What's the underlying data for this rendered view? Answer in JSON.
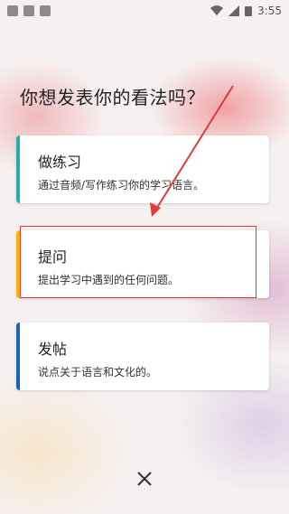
{
  "status_bar": {
    "time": "3:55"
  },
  "title": "你想发表你的看法吗？",
  "cards": [
    {
      "heading": "做练习",
      "description": "通过音频/写作练习你的学习语言。",
      "accent_color": "#2aa9b3"
    },
    {
      "heading": "提问",
      "description": "提出学习中遇到的任何问题。",
      "accent_color": "#f4b400"
    },
    {
      "heading": "发帖",
      "description": "说点关于语言和文化的。",
      "accent_color": "#1565c0"
    }
  ],
  "colors": {
    "highlight_box": "#e03a3a",
    "arrow": "#e03a3a"
  },
  "icons": {
    "close": "close-icon"
  }
}
